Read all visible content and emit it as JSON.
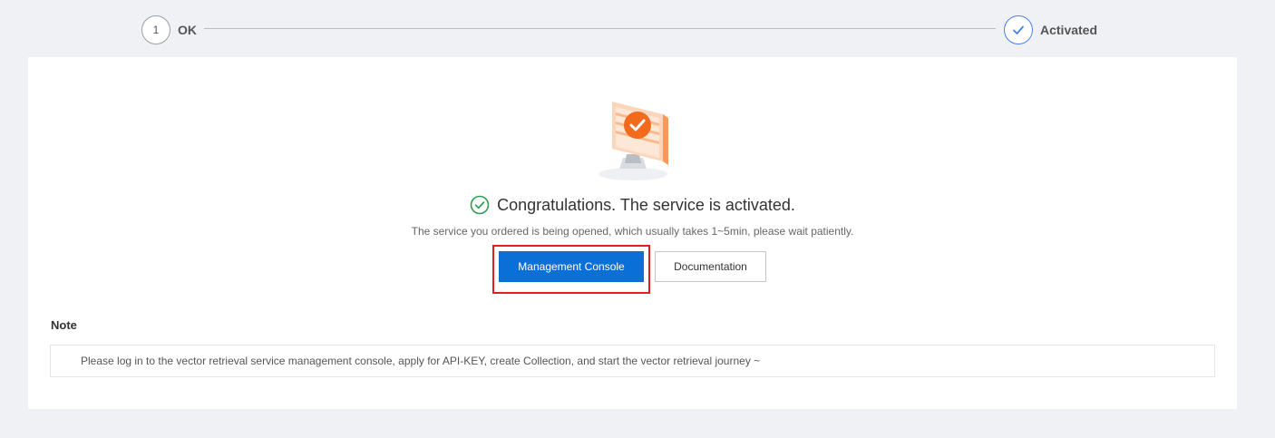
{
  "steps": [
    {
      "number": "1",
      "label": "OK",
      "state": "pending"
    },
    {
      "number": "",
      "label": "Activated",
      "state": "done"
    }
  ],
  "result": {
    "headline": "Congratulations. The service is activated.",
    "subtext": "The service you ordered is being opened, which usually takes 1~5min, please wait patiently.",
    "icon": "check-circle-icon",
    "illustration": "monitor-check-illustration"
  },
  "actions": {
    "primary_label": "Management Console",
    "secondary_label": "Documentation"
  },
  "note": {
    "title": "Note",
    "text": "Please log in to the vector retrieval service management console, apply for API-KEY, create Collection, and start the vector retrieval journey ~"
  },
  "colors": {
    "primary": "#0a6fd6",
    "success": "#2e9e4e",
    "step_done": "#4a7ff0",
    "highlight": "#e02020",
    "illustration_accent": "#f26b1d"
  }
}
